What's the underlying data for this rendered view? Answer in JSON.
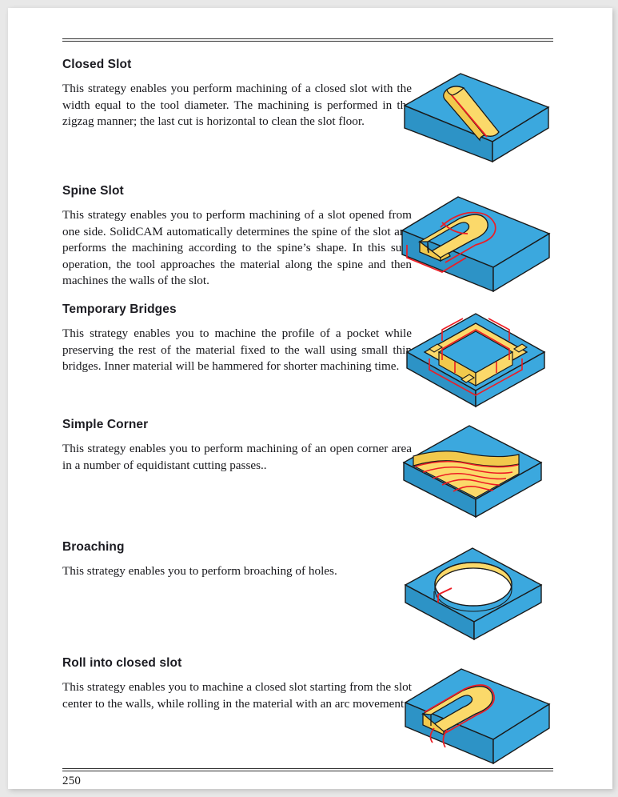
{
  "page": {
    "number": "250",
    "background_color": "#ffffff",
    "surround_color": "#e8e8e8",
    "rule_color": "#333333"
  },
  "colors": {
    "stock_blue": "#3BA8DE",
    "stock_blue_dark": "#2D93C6",
    "machined_yellow": "#FBD96A",
    "machined_yellow_dark": "#F2C94C",
    "toolpath_red": "#ED1C24",
    "outline": "#1a1a1a",
    "heading": "#1c1c22",
    "body": "#17171b"
  },
  "sections": [
    {
      "id": "closed-slot",
      "heading": "Closed Slot",
      "body": "This strategy enables you perform machining of a closed slot with the width equal to the tool diameter. The machining is performed in the zigzag manner; the last cut is horizontal to clean the slot floor.",
      "figure_name": "closed-slot-illustration"
    },
    {
      "id": "spine-slot",
      "heading": "Spine Slot",
      "body": "This strategy enables you to perform machining of a slot opened from one side. SolidCAM automatically determines the spine of the slot and performs the machining according to the spine’s shape. In this sub-operation, the tool approaches the material along the spine and then machines the walls of the slot.",
      "figure_name": "spine-slot-illustration"
    },
    {
      "id": "temporary-bridges",
      "heading": "Temporary Bridges",
      "body": "This strategy enables you to machine the profile of a pocket while preserving the rest of the material fixed to the wall using small thin bridges. Inner material will be hammered for shorter machining time.",
      "figure_name": "temporary-bridges-illustration"
    },
    {
      "id": "simple-corner",
      "heading": "Simple Corner",
      "body": "This strategy enables you to perform machining of an open corner area in a number of equidistant cutting passes..",
      "figure_name": "simple-corner-illustration"
    },
    {
      "id": "broaching",
      "heading": "Broaching",
      "body": "This strategy enables you to perform broaching of holes.",
      "figure_name": "broaching-illustration"
    },
    {
      "id": "roll-into-closed-slot",
      "heading": "Roll into closed slot",
      "body": "This strategy enables you to machine a closed slot starting from the slot center to the walls, while rolling in the material with an arc movement.",
      "figure_name": "roll-into-closed-slot-illustration"
    }
  ]
}
